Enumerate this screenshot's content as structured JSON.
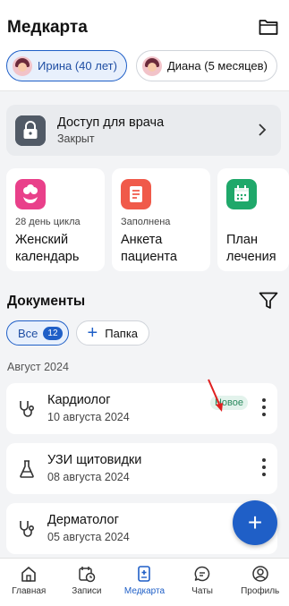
{
  "header": {
    "title": "Медкарта",
    "folder_icon": "folder-icon"
  },
  "profiles": [
    {
      "label": "Ирина (40 лет)",
      "active": true
    },
    {
      "label": "Диана (5 месяцев)",
      "active": false
    }
  ],
  "access": {
    "title": "Доступ для врача",
    "status": "Закрыт",
    "icon": "lock-icon"
  },
  "cards": [
    {
      "small": "28 день цикла",
      "title_line1": "Женский",
      "title_line2": "календарь",
      "color": "#e9408a",
      "icon": "flower-icon"
    },
    {
      "small": "Заполнена",
      "title_line1": "Анкета",
      "title_line2": "пациента",
      "color": "#f05a4a",
      "icon": "document-icon"
    },
    {
      "small": "",
      "title_line1": "План",
      "title_line2": "лечения",
      "color": "#1fa86a",
      "icon": "calendar-icon"
    }
  ],
  "documents": {
    "title": "Документы",
    "filters": {
      "all_label": "Все",
      "all_count": "12",
      "folder_label": "Папка"
    },
    "month": "Август 2024",
    "items": [
      {
        "title": "Кардиолог",
        "date": "10 августа 2024",
        "badge": "Новое",
        "icon": "stethoscope-icon"
      },
      {
        "title": "УЗИ щитовидки",
        "date": "08 августа 2024",
        "badge": "",
        "icon": "flask-icon"
      },
      {
        "title": "Дерматолог",
        "date": "05 августа 2024",
        "badge": "",
        "icon": "stethoscope-icon"
      }
    ]
  },
  "fab": {
    "label": "+"
  },
  "tabs": [
    {
      "label": "Главная",
      "icon": "home-icon",
      "active": false
    },
    {
      "label": "Записи",
      "icon": "calendar-clock-icon",
      "active": false
    },
    {
      "label": "Медкарта",
      "icon": "medcard-icon",
      "active": true
    },
    {
      "label": "Чаты",
      "icon": "chat-icon",
      "active": false
    },
    {
      "label": "Профиль",
      "icon": "profile-icon",
      "active": false
    }
  ],
  "colors": {
    "accent": "#1f5fc7",
    "badge_bg": "#e3f3ec",
    "badge_text": "#2b8a5e",
    "annotation_arrow": "#e02020"
  }
}
